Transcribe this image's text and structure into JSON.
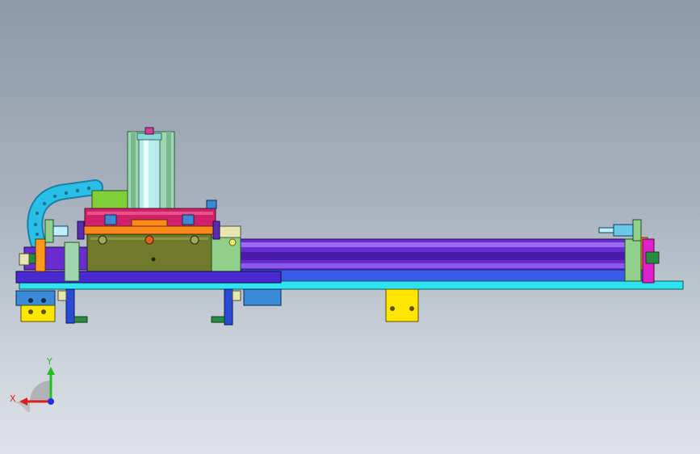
{
  "viewport": {
    "background_top": "#8e9aa8",
    "background_bottom": "#dfe3e8"
  },
  "model": {
    "colors": {
      "base_plate": "#2fe3f0",
      "rail_purple": "#6a2bd1",
      "rail_dark": "#3a1a9a",
      "carriage_olive": "#6f7a2a",
      "carriage_top": "#ff8a1a",
      "magenta_plate": "#d0206a",
      "guide_green": "#9ed6b0",
      "bracket_yellow": "#ffe600",
      "cable_chain": "#29c0e8",
      "end_block_green": "#8fd08a",
      "end_cap_magenta": "#e020c8",
      "bolt_blue": "#3a8ad8",
      "foot_blue": "#2a4ad8"
    }
  },
  "triad": {
    "x_label": "X",
    "y_label": "Y",
    "x_color": "#e02020",
    "y_color": "#20c020",
    "z_color": "#2030e0"
  }
}
